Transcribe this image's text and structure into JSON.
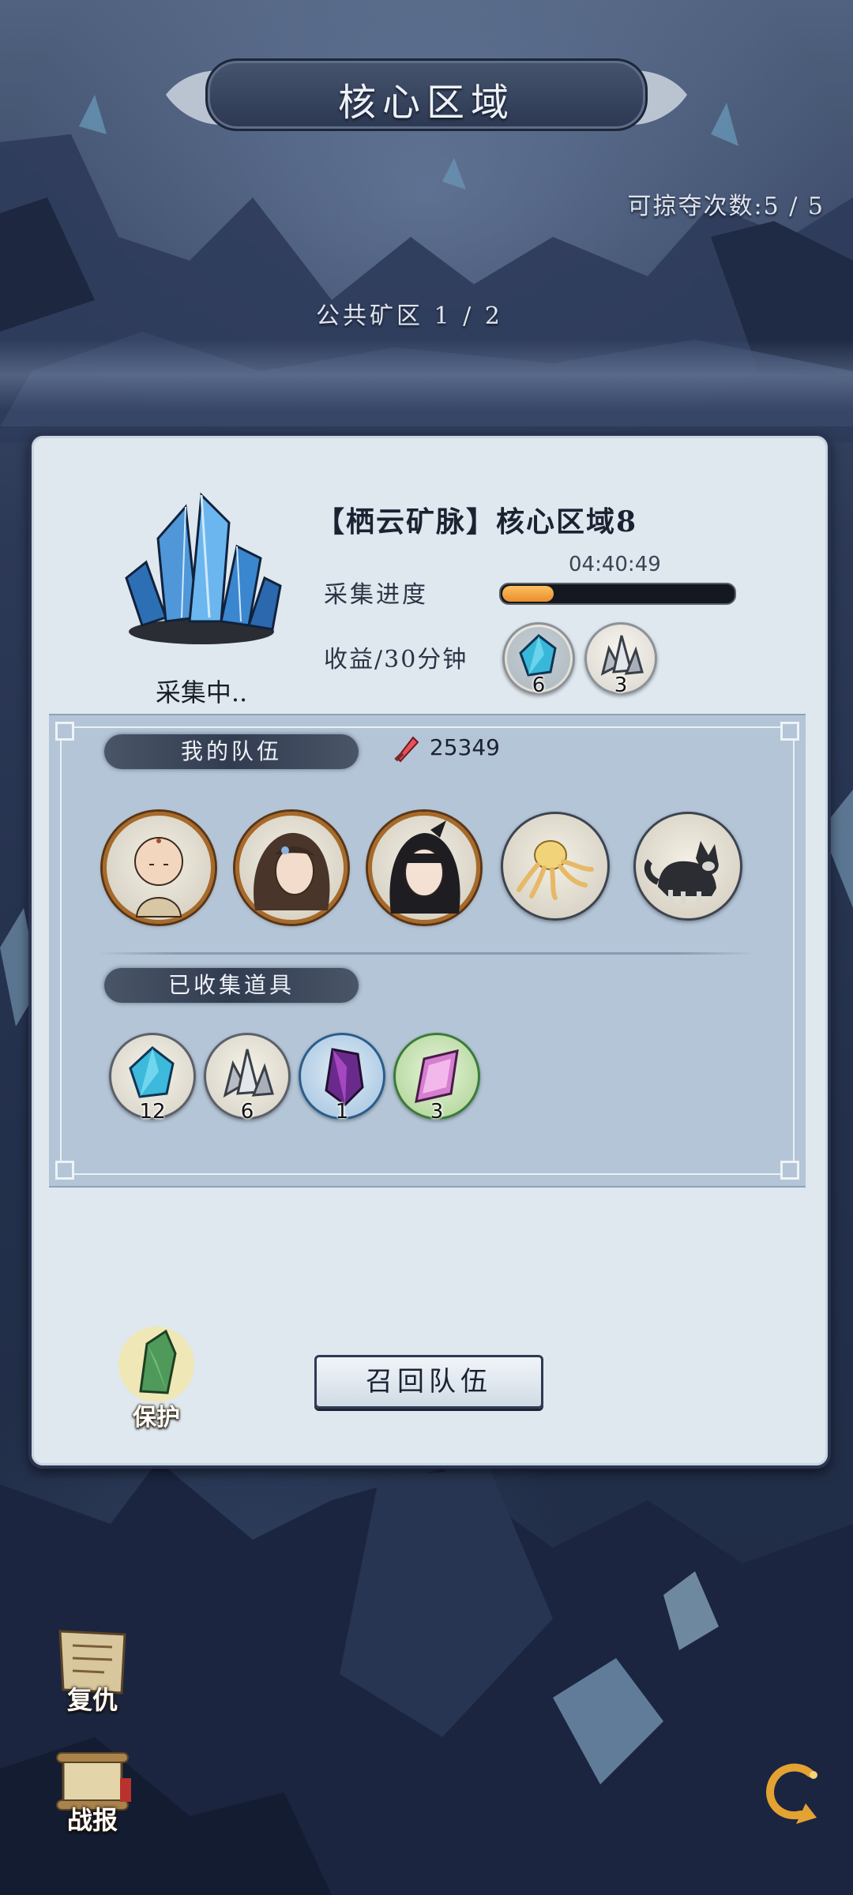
{
  "header": {
    "title": "核心区域",
    "raid_count": "可掠夺次数:5 / 5",
    "zone_page": "公共矿区  1 / 2"
  },
  "mine": {
    "name": "【栖云矿脉】核心区域8",
    "status": "采集中..",
    "timer": "04:40:49",
    "progress_label": "采集进度",
    "progress_fraction": 0.22,
    "income_label": "收益/30分钟",
    "income": [
      {
        "icon": "blue-crystal-icon",
        "count": "6"
      },
      {
        "icon": "silver-ore-icon",
        "count": "3"
      }
    ]
  },
  "team": {
    "label": "我的队伍",
    "power": "25349",
    "members": [
      {
        "icon": "monk-portrait-icon",
        "type": "hero"
      },
      {
        "icon": "brown-hair-girl-portrait-icon",
        "type": "hero"
      },
      {
        "icon": "black-hair-girl-portrait-icon",
        "type": "hero"
      },
      {
        "icon": "octopus-pet-icon",
        "type": "pet"
      },
      {
        "icon": "wolf-pup-pet-icon",
        "type": "pet"
      }
    ]
  },
  "collected": {
    "label": "已收集道具",
    "items": [
      {
        "icon": "blue-crystal-icon",
        "count": "12"
      },
      {
        "icon": "silver-ore-icon",
        "count": "6"
      },
      {
        "icon": "purple-gem-icon",
        "count": "1"
      },
      {
        "icon": "pink-gem-icon",
        "count": "3"
      }
    ]
  },
  "actions": {
    "protect": "保护",
    "recall": "召回队伍",
    "revenge": "复仇",
    "battle_report": "战报"
  },
  "colors": {
    "panel_bg": "#dfe8ef",
    "team_bg": "#b3c5d6",
    "progress": "#e88d2a",
    "hero_rim": "#a76a2a"
  }
}
